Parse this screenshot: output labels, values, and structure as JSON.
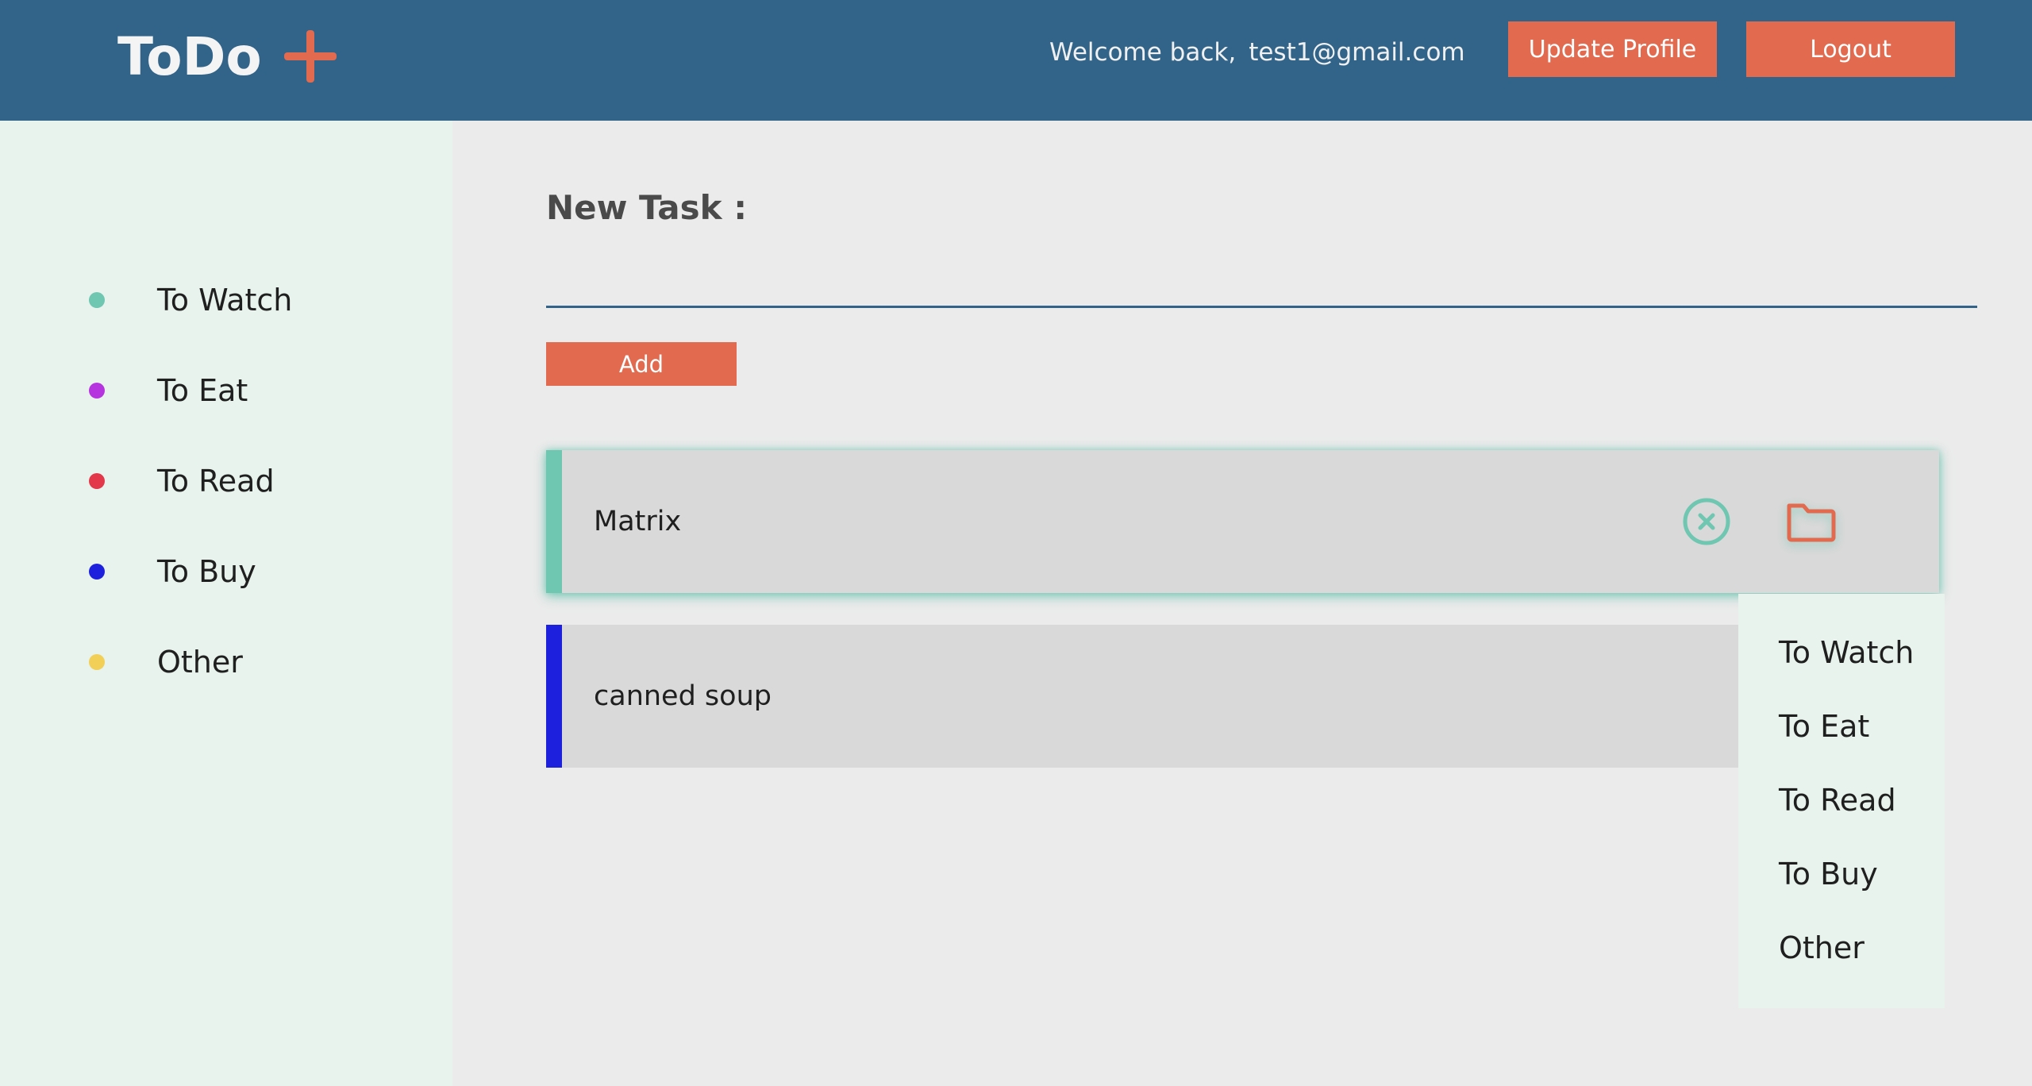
{
  "header": {
    "logo": "ToDo",
    "add_icon": "plus-icon",
    "welcome_text": "Welcome back,",
    "email": "test1@gmail.com",
    "update_profile_label": "Update Profile",
    "logout_label": "Logout"
  },
  "sidebar": {
    "items": [
      {
        "label": "To Watch",
        "color": "#6fc6b1"
      },
      {
        "label": "To Eat",
        "color": "#b534e0"
      },
      {
        "label": "To Read",
        "color": "#e2384a"
      },
      {
        "label": "To Buy",
        "color": "#1d21dd"
      },
      {
        "label": "Other",
        "color": "#f2cf57"
      }
    ]
  },
  "main": {
    "new_task_label": "New Task :",
    "task_input_value": "",
    "add_label": "Add",
    "tasks": [
      {
        "text": "Matrix",
        "color": "#6fc6b1",
        "icons": [
          "close-circle-icon",
          "folder-icon"
        ]
      },
      {
        "text": "canned soup",
        "color": "#1d21dd"
      }
    ]
  },
  "dropdown": {
    "items": [
      "To Watch",
      "To Eat",
      "To Read",
      "To Buy",
      "Other"
    ]
  },
  "colors": {
    "header_bg": "#316488",
    "accent": "#e26a4f",
    "sidebar_bg": "#e7f3ec",
    "main_bg": "#ebebeb"
  }
}
